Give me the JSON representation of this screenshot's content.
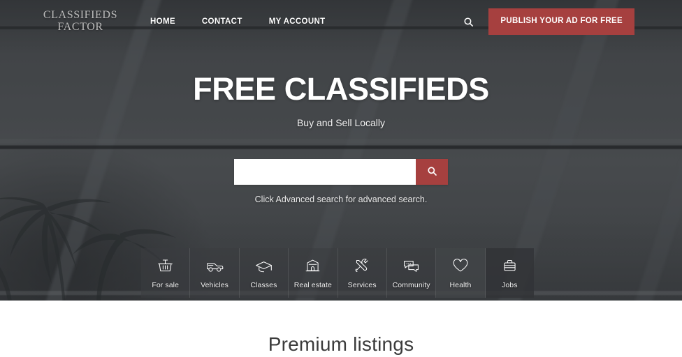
{
  "site": {
    "logo_line1": "CLASSIFIEDS",
    "logo_line2": "FACTOR"
  },
  "header": {
    "nav": [
      {
        "label": "HOME",
        "name": "nav-home"
      },
      {
        "label": "CONTACT",
        "name": "nav-contact"
      },
      {
        "label": "MY ACCOUNT",
        "name": "nav-my-account"
      }
    ],
    "search_toggle_icon": "search-icon",
    "publish_label": "PUBLISH YOUR AD FOR FREE"
  },
  "hero": {
    "title": "FREE CLASSIFIEDS",
    "subtitle": "Buy and Sell Locally",
    "search_value": "",
    "search_placeholder": "",
    "search_button_icon": "search-icon",
    "hint": "Click Advanced search for advanced search."
  },
  "categories": [
    {
      "label": "For sale",
      "icon": "basket-icon"
    },
    {
      "label": "Vehicles",
      "icon": "car-icon"
    },
    {
      "label": "Classes",
      "icon": "graduation-cap-icon"
    },
    {
      "label": "Real estate",
      "icon": "house-icon"
    },
    {
      "label": "Services",
      "icon": "tools-icon"
    },
    {
      "label": "Community",
      "icon": "speech-bubbles-icon"
    },
    {
      "label": "Health",
      "icon": "heart-icon"
    },
    {
      "label": "Jobs",
      "icon": "briefcase-icon"
    }
  ],
  "main": {
    "premium_listings_title": "Premium listings"
  },
  "colors": {
    "accent_red": "#a6403f",
    "hero_background": "#4c4f52",
    "logo_text": "#bdbdbd",
    "body_background": "#ffffff",
    "section_title": "#3b3b3b"
  }
}
